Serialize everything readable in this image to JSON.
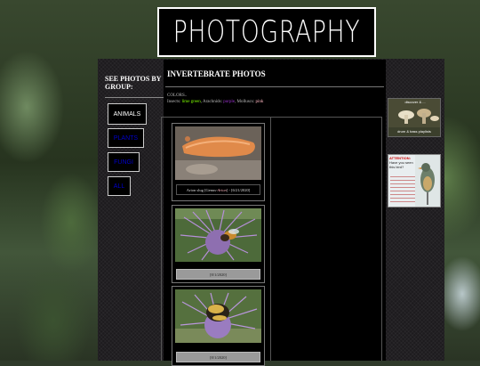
{
  "banner": {
    "title": "PHOTOGRAPHY"
  },
  "sidebar": {
    "title": "SEE PHOTOS BY GROUP:",
    "groups": [
      {
        "label": "ANIMALS",
        "color": "#ffffff"
      },
      {
        "label": "PLANTS",
        "color": "#0000cc"
      },
      {
        "label": "FUNGI",
        "color": "#0000cc"
      },
      {
        "label": "ALL",
        "color": "#0000cc"
      }
    ]
  },
  "main": {
    "title": "INVERTEBRATE PHOTOS",
    "colors_label": "COLORS..",
    "colors_legend": {
      "insects_label": "Insects:",
      "insects_value": "lime green",
      "arachnids_label": "Arachnids:",
      "arachnids_value": "purple",
      "molluscs_label": "Molluscs:",
      "molluscs_value": "pink"
    },
    "photos": [
      {
        "caption_name": "Arion slug [Genus-",
        "caption_genus": "Arion",
        "caption_end": "] -",
        "caption_date": "[6/21/2020]",
        "subject": "slug"
      },
      {
        "caption_date": "[8/1/2020]",
        "subject": "honeybee"
      },
      {
        "caption_date": "[8/1/2020]",
        "subject": "bumblebee"
      }
    ]
  },
  "ads": [
    {
      "top_text": "discover & ...",
      "bottom_text": "drum & bass playlists"
    },
    {
      "text_lines": [
        "ATTENTION:",
        "Have you seen",
        "this bird?"
      ]
    }
  ],
  "colors": {
    "insects": "#7fff00",
    "arachnids": "#9933cc",
    "molluscs": "#ffb6c1"
  }
}
